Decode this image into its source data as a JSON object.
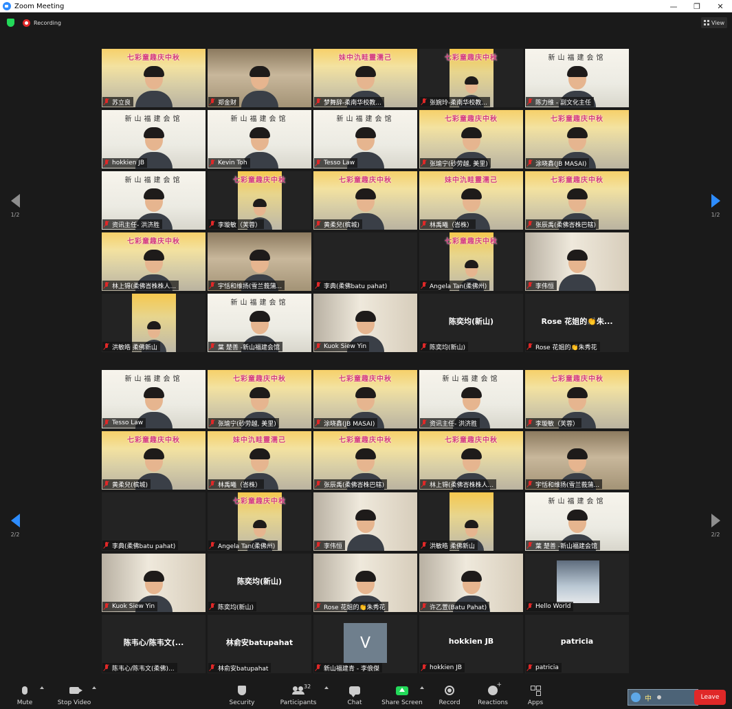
{
  "window": {
    "title": "Zoom Meeting",
    "controls": [
      "—",
      "❐",
      "✕"
    ]
  },
  "topbar": {
    "recording_label": "Recording",
    "view_label": "View"
  },
  "page1": {
    "nav_left_label": "1/2",
    "nav_right_label": "1/2",
    "tiles": [
      {
        "name": "苏立良",
        "bg": "banner",
        "banner": "七彩童趣庆中秋",
        "video": true
      },
      {
        "name": "郑金财",
        "bg": "room",
        "banner": "",
        "video": true
      },
      {
        "name": "梦舞辞-柔南华校教...",
        "bg": "banner",
        "banner": "妹中氿畦靈濡己",
        "video": true
      },
      {
        "name": "张婉玲-柔南华校教...",
        "bg": "portrait",
        "banner": "七彩童趣庆中秋",
        "video": true
      },
      {
        "name": "陈力维 - 副文化主任",
        "bg": "hall",
        "banner": "新山福建会馆",
        "video": true
      },
      {
        "name": "hokkien JB",
        "bg": "hall",
        "banner": "新山福建会馆",
        "video": true,
        "active": true
      },
      {
        "name": "Kevin Toh",
        "bg": "hall",
        "banner": "新山福建会馆",
        "video": true
      },
      {
        "name": "Tesso Law",
        "bg": "hall",
        "banner": "新山福建会馆",
        "video": true
      },
      {
        "name": "张瑜宁(砂劳越, 美里)",
        "bg": "banner",
        "banner": "七彩童趣庆中秋",
        "video": true
      },
      {
        "name": "涂晓鑫(JB MASAI)",
        "bg": "banner",
        "banner": "七彩童趣庆中秋",
        "video": true
      },
      {
        "name": "资讯主任- 洪济胜",
        "bg": "hall",
        "banner": "新山福建会馆",
        "video": true
      },
      {
        "name": "李璇敏（芙蓉）",
        "bg": "portrait",
        "banner": "七彩童趣庆中秋",
        "video": true
      },
      {
        "name": "黄柔兒(槟城)",
        "bg": "banner",
        "banner": "七彩童趣庆中秋",
        "video": true
      },
      {
        "name": "林禹曦（峇株）",
        "bg": "banner",
        "banner": "妹中氿畦靈濡己",
        "video": true
      },
      {
        "name": "张辰禹(柔佛峇株巴辖)",
        "bg": "banner",
        "banner": "七彩童趣庆中秋",
        "video": true
      },
      {
        "name": "林上锝(柔佛峇株株人...",
        "bg": "banner",
        "banner": "七彩童趣庆中秋",
        "video": true
      },
      {
        "name": "宇恬和维扬(雪兰莪蒲...",
        "bg": "room",
        "banner": "",
        "video": true
      },
      {
        "name": "李典(柔佛batu pahat)",
        "bg": "none",
        "banner": "",
        "video": false
      },
      {
        "name": "Angela Tan(柔佛州)",
        "bg": "portrait",
        "banner": "七彩童趣庆中秋",
        "video": true
      },
      {
        "name": "李伟恒",
        "bg": "office",
        "banner": "",
        "video": true
      },
      {
        "name": "洪敏皓 柔佛新山",
        "bg": "portrait",
        "banner": "",
        "video": true
      },
      {
        "name": "葉 楚善 -新山福建会馆",
        "bg": "hall",
        "banner": "新山福建会馆",
        "video": true
      },
      {
        "name": "Kuok Siew Yin",
        "bg": "office",
        "banner": "",
        "video": true
      },
      {
        "name": "陈奕均(新山)",
        "bg": "none",
        "banner": "",
        "video": false,
        "center": "陈奕均(新山)"
      },
      {
        "name": "Rose 花姐的👏朱秀花",
        "bg": "none",
        "banner": "",
        "video": false,
        "center": "Rose 花姐的👏朱..."
      }
    ]
  },
  "page2": {
    "nav_left_label": "2/2",
    "nav_right_label": "2/2",
    "tiles": [
      {
        "name": "Tesso Law",
        "bg": "hall",
        "banner": "新山福建会馆",
        "video": true
      },
      {
        "name": "张瑜宁(砂劳越, 美里)",
        "bg": "banner",
        "banner": "七彩童趣庆中秋",
        "video": true
      },
      {
        "name": "涂晓鑫(JB MASAI)",
        "bg": "banner",
        "banner": "七彩童趣庆中秋",
        "video": true
      },
      {
        "name": "资讯主任- 洪济胜",
        "bg": "hall",
        "banner": "新山福建会馆",
        "video": true
      },
      {
        "name": "李璇敏（芙蓉）",
        "bg": "banner",
        "banner": "七彩童趣庆中秋",
        "video": true
      },
      {
        "name": "黄柔兒(槟城)",
        "bg": "banner",
        "banner": "七彩童趣庆中秋",
        "video": true
      },
      {
        "name": "林禹曦（峇株）",
        "bg": "banner",
        "banner": "妹中氿畦靈濡己",
        "video": true
      },
      {
        "name": "张辰禹(柔佛峇株巴辖)",
        "bg": "banner",
        "banner": "七彩童趣庆中秋",
        "video": true
      },
      {
        "name": "林上锝(柔佛峇株株人...",
        "bg": "banner",
        "banner": "七彩童趣庆中秋",
        "video": true
      },
      {
        "name": "宇恬和维扬(雪兰莪蒲...",
        "bg": "room",
        "banner": "",
        "video": true
      },
      {
        "name": "李典(柔佛batu pahat)",
        "bg": "none",
        "banner": "",
        "video": false
      },
      {
        "name": "Angela Tan(柔佛州)",
        "bg": "portrait",
        "banner": "七彩童趣庆中秋",
        "video": true
      },
      {
        "name": "李伟恒",
        "bg": "office",
        "banner": "",
        "video": true
      },
      {
        "name": "洪敏皓 柔佛新山",
        "bg": "portrait",
        "banner": "",
        "video": true
      },
      {
        "name": "葉 楚善 -新山福建会馆",
        "bg": "hall",
        "banner": "新山福建会馆",
        "video": true
      },
      {
        "name": "Kuok Siew Yin",
        "bg": "office",
        "banner": "",
        "video": true
      },
      {
        "name": "陈奕均(新山)",
        "bg": "none",
        "banner": "",
        "video": false,
        "center": "陈奕均(新山)"
      },
      {
        "name": "Rose 花姐的👏朱秀花",
        "bg": "office",
        "banner": "",
        "video": true
      },
      {
        "name": "许乙萱(Batu Pahat)",
        "bg": "office",
        "banner": "",
        "video": true
      },
      {
        "name": "Hello World",
        "bg": "none",
        "banner": "",
        "video": false,
        "picture": true
      },
      {
        "name": "陈韦心/陈韦文(柔佛)...",
        "bg": "none",
        "banner": "",
        "video": false,
        "center": "陈韦心/陈韦文(..."
      },
      {
        "name": "林俞安batupahat",
        "bg": "none",
        "banner": "",
        "video": false,
        "center": "林俞安batupahat"
      },
      {
        "name": "新山福建青 - 李俍傑",
        "bg": "none",
        "banner": "",
        "video": false,
        "avatar": "V"
      },
      {
        "name": "hokkien JB",
        "bg": "none",
        "banner": "",
        "video": false,
        "center": "hokkien JB"
      },
      {
        "name": "patricia",
        "bg": "none",
        "banner": "",
        "video": false,
        "center": "patricia"
      }
    ]
  },
  "toolbar": {
    "mute_label": "Mute",
    "video_label": "Stop Video",
    "security_label": "Security",
    "participants_label": "Participants",
    "participants_count": "32",
    "chat_label": "Chat",
    "share_label": "Share Screen",
    "record_label": "Record",
    "reactions_label": "Reactions",
    "apps_label": "Apps",
    "leave_label": "Leave",
    "ime_char": "中"
  },
  "colors": {
    "accent": "#2d8cff",
    "active_speaker": "#c5e83b",
    "share_green": "#23d959",
    "muted_red": "#e02828"
  }
}
